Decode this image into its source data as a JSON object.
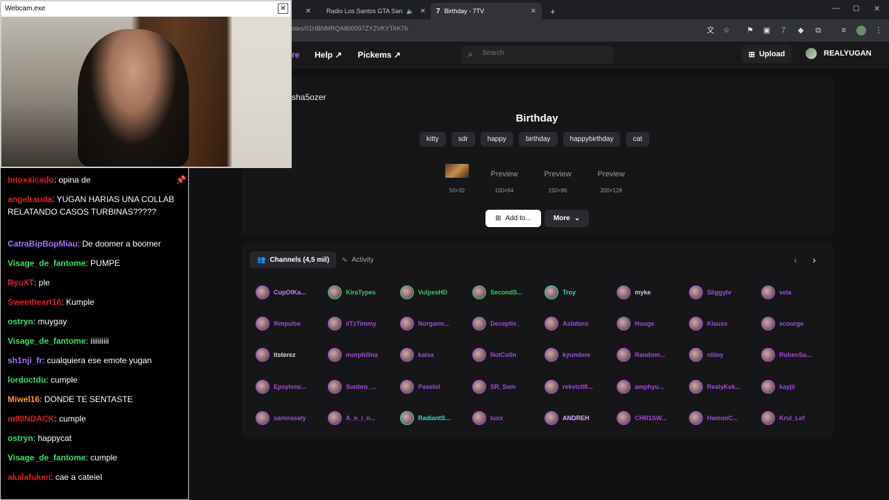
{
  "browser": {
    "tabs": [
      {
        "label": "Radio Los Santos GTA San",
        "icon": "youtube-icon"
      },
      {
        "label": "Birthday - 7TV",
        "icon": "7tv-icon",
        "active": true
      }
    ],
    "new_tab": "+",
    "url": "otes/01HBNMRQA800097ZYZVKYTAK76"
  },
  "site": {
    "nav_partial": "re",
    "nav": [
      {
        "label": "Help"
      },
      {
        "label": "Pickems"
      }
    ],
    "search_placeholder": "Search",
    "upload_label": "Upload",
    "username": "REALYUGAN"
  },
  "emote": {
    "owner": "sha5ozer",
    "name": "Birthday",
    "tags": [
      "kitty",
      "sdr",
      "happy",
      "birthday",
      "happybirthday",
      "cat"
    ],
    "previews": [
      {
        "alt": "",
        "size": "50×32"
      },
      {
        "alt": "Preview",
        "size": "100×64"
      },
      {
        "alt": "Preview",
        "size": "150×96"
      },
      {
        "alt": "Preview",
        "size": "200×128"
      }
    ],
    "add_label": "Add to...",
    "more_label": "More"
  },
  "channels": {
    "tab_channels": "Channels (4,5 mil)",
    "tab_activity": "Activity",
    "rows": [
      [
        {
          "name": "CupOfKa...",
          "color": "#c77dff"
        },
        {
          "name": "KiraTypes",
          "color": "#3ec96a"
        },
        {
          "name": "VulpesHD",
          "color": "#3ec96a"
        },
        {
          "name": "SecondS...",
          "color": "#3ec96a"
        },
        {
          "name": "Troy",
          "color": "#40d6c4"
        },
        {
          "name": "myke",
          "color": "#e0c0e0"
        },
        {
          "name": "Sliggytv",
          "color": "#a34bd9"
        },
        {
          "name": "vela",
          "color": "#a34bd9"
        }
      ],
      [
        {
          "name": "9impulse",
          "color": "#a34bd9"
        },
        {
          "name": "iiTzTimmy",
          "color": "#a34bd9"
        },
        {
          "name": "Norgann...",
          "color": "#a34bd9"
        },
        {
          "name": "Deceptix_",
          "color": "#a34bd9"
        },
        {
          "name": "Astatoro",
          "color": "#a34bd9"
        },
        {
          "name": "Huuge",
          "color": "#a34bd9"
        },
        {
          "name": "Klauss",
          "color": "#a34bd9"
        },
        {
          "name": "scourge",
          "color": "#a34bd9"
        }
      ],
      [
        {
          "name": "itsterez",
          "color": "#d8d8d8"
        },
        {
          "name": "morphilina",
          "color": "#a34bd9"
        },
        {
          "name": "kaisa",
          "color": "#a34bd9"
        },
        {
          "name": "NotColln",
          "color": "#a34bd9"
        },
        {
          "name": "kyundere",
          "color": "#a34bd9"
        },
        {
          "name": "Random...",
          "color": "#a34bd9"
        },
        {
          "name": "niiiny",
          "color": "#a34bd9"
        },
        {
          "name": "RubenSa...",
          "color": "#a34bd9"
        }
      ],
      [
        {
          "name": "Epsylonc...",
          "color": "#a34bd9"
        },
        {
          "name": "Sunbro_...",
          "color": "#a34bd9"
        },
        {
          "name": "Paxelol",
          "color": "#a34bd9"
        },
        {
          "name": "SR_Sam",
          "color": "#a34bd9"
        },
        {
          "name": "rekvizit8...",
          "color": "#a34bd9"
        },
        {
          "name": "amphyu...",
          "color": "#a34bd9"
        },
        {
          "name": "RealyKek...",
          "color": "#a34bd9"
        },
        {
          "name": "kayjii",
          "color": "#a34bd9"
        }
      ],
      [
        {
          "name": "samirasaly",
          "color": "#a34bd9"
        },
        {
          "name": "A_n_i_n...",
          "color": "#a34bd9"
        },
        {
          "name": "RadiantS...",
          "color": "#40d6c4"
        },
        {
          "name": "luxx",
          "color": "#a34bd9"
        },
        {
          "name": "ANDREH",
          "color": "#e0b0ff"
        },
        {
          "name": "CHR1SW...",
          "color": "#a34bd9"
        },
        {
          "name": "HamonC...",
          "color": "#a34bd9"
        },
        {
          "name": "Krul_Lef",
          "color": "#a34bd9"
        }
      ]
    ]
  },
  "webcam": {
    "title": "Webcam.exe",
    "close": "✕"
  },
  "chat": {
    "messages": [
      {
        "user": "Intoxxicado",
        "color": "#e0202a",
        "text": "opina de"
      },
      {
        "user": "angelrauda",
        "color": "#e0202a",
        "text": "YUGAN HARIAS UNA COLLAB RELATANDO CASOS TURBINAS?????"
      },
      {
        "user": "CatraBipBopMiau",
        "color": "#a970ff",
        "text": "De doomer a boomer"
      },
      {
        "user": "Visage_de_fantome",
        "color": "#3ee06a",
        "text": "PUMPE"
      },
      {
        "user": "RyuXT",
        "color": "#e0202a",
        "text": "ple"
      },
      {
        "user": "Sweetheart16",
        "color": "#e0202a",
        "text": "Kumple"
      },
      {
        "user": "ostryn",
        "color": "#3ee06a",
        "text": "muygay"
      },
      {
        "user": "Visage_de_fantome",
        "color": "#3ee06a",
        "text": "iiiiiiiiii"
      },
      {
        "user": "sh1nji_fr",
        "color": "#a970ff",
        "text": "cualquiera ese emote yugan"
      },
      {
        "user": "lordoctdu",
        "color": "#3ee06a",
        "text": "cumple"
      },
      {
        "user": "Miwel16",
        "color": "#ff9a2e",
        "text": "DONDE TE SENTASTE"
      },
      {
        "user": "m00NDACK",
        "color": "#e0202a",
        "text": "cumple"
      },
      {
        "user": "ostryn",
        "color": "#3ee06a",
        "text": "happycat"
      },
      {
        "user": "Visage_de_fantome",
        "color": "#3ee06a",
        "text": "cumple"
      },
      {
        "user": "akalafuken",
        "color": "#e0202a",
        "text": "cae a cateiel"
      }
    ]
  }
}
